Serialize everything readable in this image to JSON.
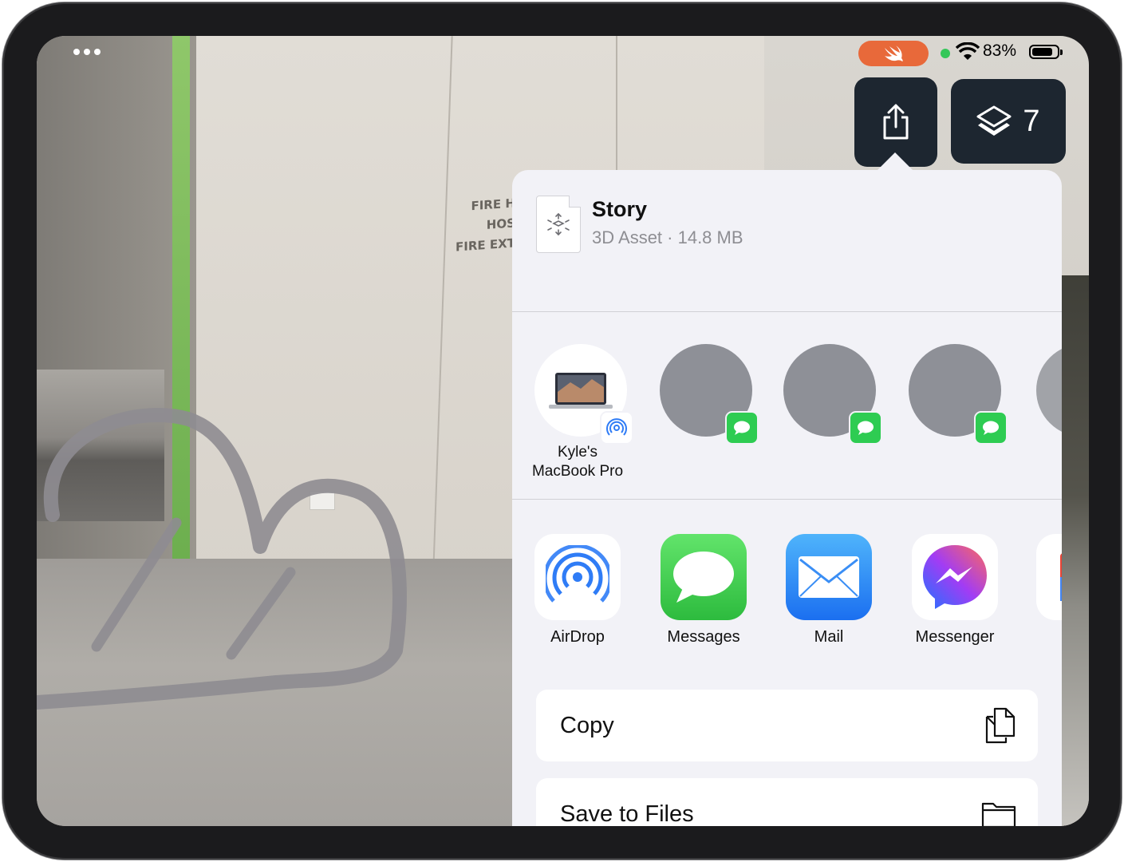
{
  "status_bar": {
    "battery_percent": "83%",
    "battery_level": 0.83,
    "accent_color": "#e8693a"
  },
  "toolbar": {
    "share_icon": "share-icon",
    "layers_icon": "layers-icon",
    "layers_count": "7"
  },
  "share_sheet": {
    "file": {
      "title": "Story",
      "subtitle": "3D Asset · 14.8 MB",
      "icon": "3d-asset-icon"
    },
    "people": [
      {
        "name": "Kyle's\nMacBook Pro",
        "badge": "airdrop-icon"
      },
      {
        "name": "",
        "badge": "messages-icon"
      },
      {
        "name": "",
        "badge": "messages-icon"
      },
      {
        "name": "",
        "badge": "messages-icon"
      }
    ],
    "apps": [
      {
        "label": "AirDrop",
        "icon": "airdrop-icon"
      },
      {
        "label": "Messages",
        "icon": "messages-icon"
      },
      {
        "label": "Mail",
        "icon": "mail-icon"
      },
      {
        "label": "Messenger",
        "icon": "messenger-icon"
      }
    ],
    "actions": [
      {
        "label": "Copy",
        "icon": "copy-icon"
      },
      {
        "label": "Save to Files",
        "icon": "folder-icon"
      }
    ]
  },
  "scene": {
    "sign_lines": [
      "FIRE H",
      "HOS",
      "FIRE EXT"
    ]
  }
}
